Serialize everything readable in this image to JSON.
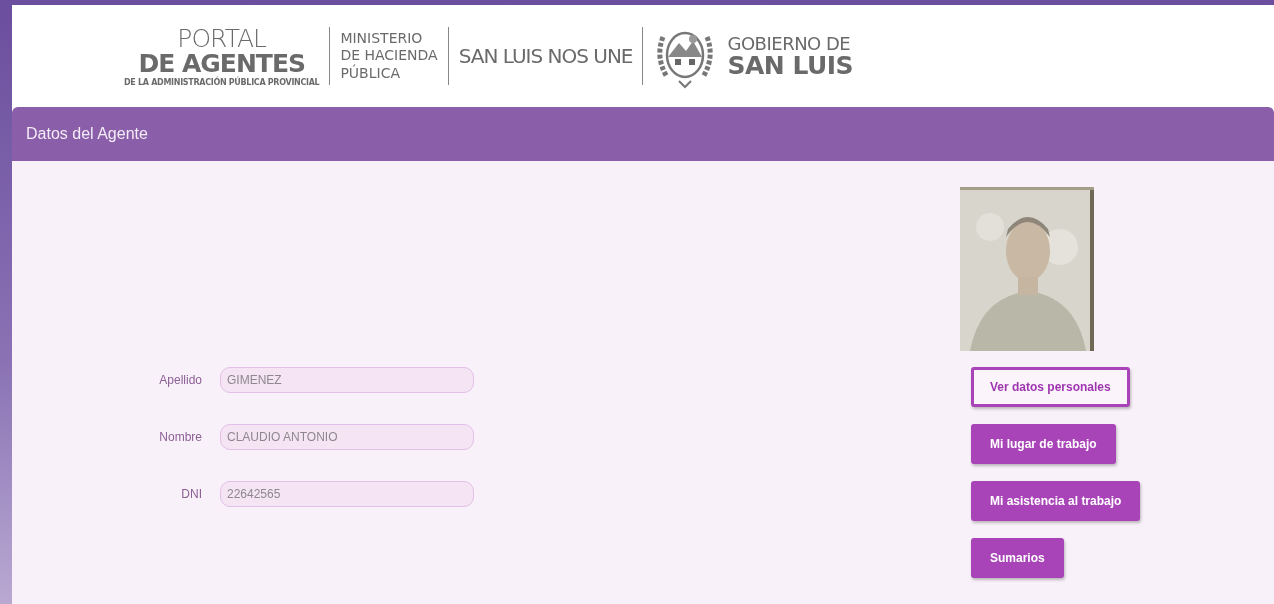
{
  "header": {
    "portal_title": "PORTAL",
    "portal_subtitle": "DE AGENTES",
    "portal_caption": "DE LA ADMINISTRACIÓN PÚBLICA PROVINCIAL",
    "ministry_lines": [
      "MINISTERIO",
      "DE HACIENDA",
      "PÚBLICA"
    ],
    "slogan": "SAN LUIS NOS UNE",
    "government_top": "GOBIERNO DE",
    "government_bottom": "SAN LUIS"
  },
  "panel": {
    "title": "Datos del Agente"
  },
  "fields": [
    {
      "label": "Apellido",
      "value": "GIMENEZ"
    },
    {
      "label": "Nombre",
      "value": "CLAUDIO ANTONIO"
    },
    {
      "label": "DNI",
      "value": "22642565"
    }
  ],
  "buttons": [
    {
      "label": "Ver datos personales",
      "selected": true
    },
    {
      "label": "Mi lugar de trabajo",
      "selected": false
    },
    {
      "label": "Mi asistencia al trabajo",
      "selected": false
    },
    {
      "label": "Sumarios",
      "selected": false
    }
  ]
}
